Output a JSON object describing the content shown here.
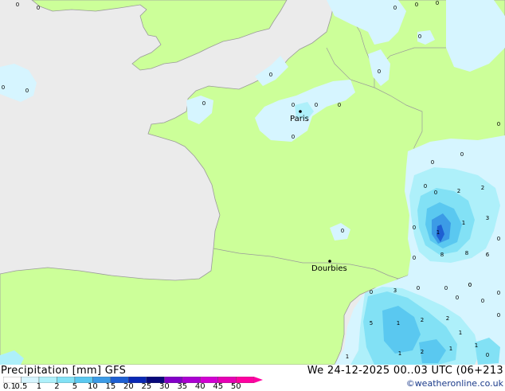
{
  "map": {
    "cities": [
      {
        "name": "Paris"
      },
      {
        "name": "Dourbies"
      }
    ],
    "values": [
      "0",
      "0",
      "0",
      "0",
      "0",
      "0",
      "0",
      "0",
      "0",
      "0",
      "0",
      "0",
      "0",
      "0",
      "0",
      "0",
      "0",
      "0",
      "0",
      "0",
      "0",
      "0",
      "0",
      "0",
      "0",
      "0",
      "0",
      "2",
      "2",
      "1",
      "3",
      "1",
      "8",
      "8",
      "6",
      "0",
      "0",
      "0",
      "0",
      "3",
      "5",
      "1",
      "2",
      "2",
      "1",
      "2",
      "1",
      "1",
      "1",
      "1",
      "0",
      "0",
      "0"
    ]
  },
  "legend": {
    "title": "Precipitation [mm]  GFS",
    "ticks": [
      "0.1",
      "0.5",
      "1",
      "2",
      "5",
      "10",
      "15",
      "20",
      "25",
      "30",
      "35",
      "40",
      "45",
      "50"
    ],
    "colors": [
      "#ffffff",
      "#d6f5ff",
      "#aef0fa",
      "#82e1f5",
      "#5ac8f0",
      "#3c9be6",
      "#1e5fd2",
      "#0a28b4",
      "#08087a",
      "#8200c8",
      "#aa00d2",
      "#d200d2",
      "#e600b4",
      "#ff00a0"
    ]
  },
  "footer": {
    "datetime": "We 24-12-2025 00..03 UTC (06+213",
    "credit": "©weatheronline.co.uk"
  },
  "colors": {
    "land": "#ccff99",
    "sea": "#ebebeb",
    "border": "#9a9a9a"
  }
}
